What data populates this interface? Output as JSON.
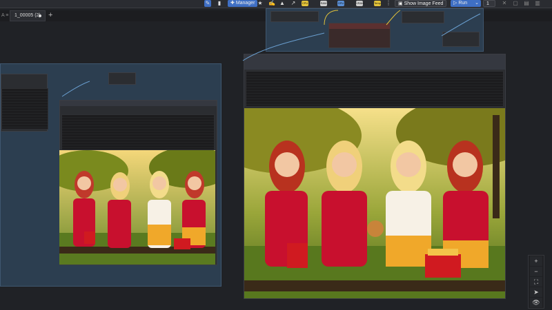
{
  "tab": {
    "label": "1_00005 (2)"
  },
  "toolbar": {
    "manager_label": "Manager",
    "show_image_feed_label": "Show Image Feed",
    "run_label": "Run",
    "batch_count": "1"
  },
  "colors": {
    "canvas_bg": "#202226",
    "group_bg": "#2c3e50",
    "node_bg": "#2b2d31",
    "accent_blue": "#3f6fc4",
    "link_blue": "#6a9fd0"
  },
  "chips": [
    {
      "label": "CPU",
      "color": "#e4c43a"
    },
    {
      "label": "RAM",
      "color": "#cfcfcf"
    },
    {
      "label": "GPU",
      "color": "#5a8fd6"
    },
    {
      "label": "VRAM",
      "color": "#cfcfcf"
    },
    {
      "label": "Temp",
      "color": "#e4c43a"
    }
  ],
  "canvas_tools": {
    "zoom_in": "+",
    "zoom_out": "−",
    "fit": "⛶",
    "locate": "➤",
    "visibility": "👁"
  }
}
